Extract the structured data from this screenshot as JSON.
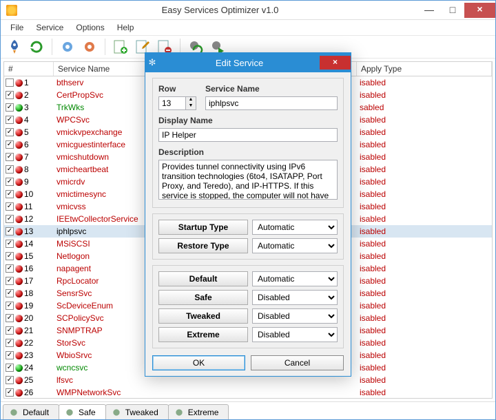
{
  "window": {
    "title": "Easy Services Optimizer v1.0",
    "min": "—",
    "max": "□",
    "close": "×"
  },
  "menu": {
    "file": "File",
    "service": "Service",
    "options": "Options",
    "help": "Help"
  },
  "headers": {
    "num": "#",
    "name": "Service Name",
    "apply": "Apply Type"
  },
  "rows": [
    {
      "n": "1",
      "name": "bthserv",
      "apply": "isabled",
      "dot": "red",
      "checked": false,
      "cls": "red-text"
    },
    {
      "n": "2",
      "name": "CertPropSvc",
      "apply": "isabled",
      "dot": "red",
      "checked": true,
      "cls": "red-text"
    },
    {
      "n": "3",
      "name": "TrkWks",
      "apply": "sabled",
      "dot": "green",
      "checked": true,
      "cls": "green-text"
    },
    {
      "n": "4",
      "name": "WPCSvc",
      "apply": "isabled",
      "dot": "red",
      "checked": true,
      "cls": "red-text"
    },
    {
      "n": "5",
      "name": "vmickvpexchange",
      "apply": "isabled",
      "dot": "red",
      "checked": true,
      "cls": "red-text"
    },
    {
      "n": "6",
      "name": "vmicguestinterface",
      "apply": "isabled",
      "dot": "red",
      "checked": true,
      "cls": "red-text"
    },
    {
      "n": "7",
      "name": "vmicshutdown",
      "apply": "isabled",
      "dot": "red",
      "checked": true,
      "cls": "red-text"
    },
    {
      "n": "8",
      "name": "vmicheartbeat",
      "apply": "isabled",
      "dot": "red",
      "checked": true,
      "cls": "red-text"
    },
    {
      "n": "9",
      "name": "vmicrdv",
      "apply": "isabled",
      "dot": "red",
      "checked": true,
      "cls": "red-text"
    },
    {
      "n": "10",
      "name": "vmictimesync",
      "apply": "isabled",
      "dot": "red",
      "checked": true,
      "cls": "red-text"
    },
    {
      "n": "11",
      "name": "vmicvss",
      "apply": "isabled",
      "dot": "red",
      "checked": true,
      "cls": "red-text"
    },
    {
      "n": "12",
      "name": "IEEtwCollectorService",
      "apply": "isabled",
      "dot": "red",
      "checked": true,
      "cls": "red-text"
    },
    {
      "n": "13",
      "name": "iphlpsvc",
      "apply": "isabled",
      "dot": "red",
      "checked": true,
      "cls": "black-text",
      "sel": true
    },
    {
      "n": "14",
      "name": "MSiSCSI",
      "apply": "isabled",
      "dot": "red",
      "checked": true,
      "cls": "red-text"
    },
    {
      "n": "15",
      "name": "Netlogon",
      "apply": "isabled",
      "dot": "red",
      "checked": true,
      "cls": "red-text"
    },
    {
      "n": "16",
      "name": "napagent",
      "apply": "isabled",
      "dot": "red",
      "checked": true,
      "cls": "red-text"
    },
    {
      "n": "17",
      "name": "RpcLocator",
      "apply": "isabled",
      "dot": "red",
      "checked": true,
      "cls": "red-text"
    },
    {
      "n": "18",
      "name": "SensrSvc",
      "apply": "isabled",
      "dot": "red",
      "checked": true,
      "cls": "red-text"
    },
    {
      "n": "19",
      "name": "ScDeviceEnum",
      "apply": "isabled",
      "dot": "red",
      "checked": true,
      "cls": "red-text"
    },
    {
      "n": "20",
      "name": "SCPolicySvc",
      "apply": "isabled",
      "dot": "red",
      "checked": true,
      "cls": "red-text"
    },
    {
      "n": "21",
      "name": "SNMPTRAP",
      "apply": "isabled",
      "dot": "red",
      "checked": true,
      "cls": "red-text"
    },
    {
      "n": "22",
      "name": "StorSvc",
      "apply": "isabled",
      "dot": "red",
      "checked": true,
      "cls": "red-text"
    },
    {
      "n": "23",
      "name": "WbioSrvc",
      "apply": "isabled",
      "dot": "red",
      "checked": true,
      "cls": "red-text"
    },
    {
      "n": "24",
      "name": "wcncsvc",
      "apply": "isabled",
      "dot": "green",
      "checked": true,
      "cls": "green-text"
    },
    {
      "n": "25",
      "name": "lfsvc",
      "apply": "isabled",
      "dot": "red",
      "checked": true,
      "cls": "red-text"
    },
    {
      "n": "26",
      "name": "WMPNetworkSvc",
      "apply": "isabled",
      "dot": "red",
      "checked": true,
      "cls": "red-text"
    }
  ],
  "tabs": {
    "default": "Default",
    "safe": "Safe",
    "tweaked": "Tweaked",
    "extreme": "Extreme"
  },
  "dialog": {
    "title": "Edit Service",
    "close": "×",
    "row_label": "Row",
    "row_value": "13",
    "name_label": "Service Name",
    "name_value": "iphlpsvc",
    "display_label": "Display Name",
    "display_value": "IP Helper",
    "desc_label": "Description",
    "desc_value": "Provides tunnel connectivity using IPv6 transition technologies (6to4, ISATAPP, Port Proxy, and Teredo), and IP-HTTPS. If this service is stopped, the computer will not have",
    "startup": "Startup Type",
    "restore": "Restore Type",
    "opt_auto": "Automatic",
    "default": "Default",
    "safe": "Safe",
    "tweaked": "Tweaked",
    "extreme": "Extreme",
    "opt_disabled": "Disabled",
    "ok": "OK",
    "cancel": "Cancel"
  }
}
